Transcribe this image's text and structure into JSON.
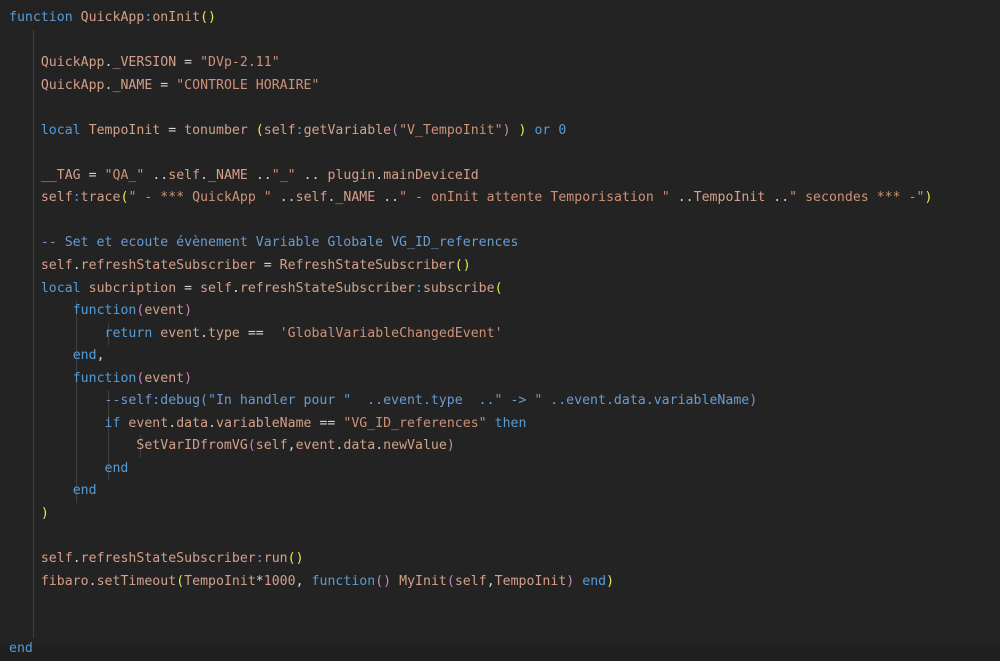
{
  "editor": {
    "language": "lua",
    "background_color": "#232323",
    "indent_guide_color": "#404040",
    "font_size_px": 13,
    "line_height_px": 23,
    "tab_size": 4,
    "colors": {
      "keyword": "#569cd6",
      "identifier": "#d4a08a",
      "string": "#ce9178",
      "comment": "#6a9bd1",
      "operator": "#d4d4d4",
      "bracket_level_1": "#e8e84f",
      "bracket_level_2": "#c586c0",
      "bracket_level_3": "#569cd6"
    }
  },
  "code": {
    "title": "QuickApp:onInit",
    "lines": [
      {
        "n": 1,
        "indent": 0,
        "guides": [],
        "text": "function QuickApp:onInit()"
      },
      {
        "n": 2,
        "indent": 0,
        "guides": [
          0
        ],
        "text": ""
      },
      {
        "n": 3,
        "indent": 1,
        "guides": [
          0
        ],
        "text": "    QuickApp._VERSION = \"DVp-2.11\""
      },
      {
        "n": 4,
        "indent": 1,
        "guides": [
          0
        ],
        "text": "    QuickApp._NAME = \"CONTROLE HORAIRE\""
      },
      {
        "n": 5,
        "indent": 1,
        "guides": [
          0
        ],
        "text": ""
      },
      {
        "n": 6,
        "indent": 1,
        "guides": [
          0
        ],
        "text": "    local TempoInit = tonumber (self:getVariable(\"V_TempoInit\") ) or 0"
      },
      {
        "n": 7,
        "indent": 1,
        "guides": [
          0
        ],
        "text": ""
      },
      {
        "n": 8,
        "indent": 1,
        "guides": [
          0
        ],
        "text": "    __TAG = \"QA_\" ..self._NAME ..\"_\" .. plugin.mainDeviceId"
      },
      {
        "n": 9,
        "indent": 1,
        "guides": [
          0
        ],
        "text": "    self:trace(\" - *** QuickApp \" ..self._NAME ..\" - onInit attente Temporisation \" ..TempoInit ..\" secondes *** -\")"
      },
      {
        "n": 10,
        "indent": 1,
        "guides": [
          0
        ],
        "text": ""
      },
      {
        "n": 11,
        "indent": 1,
        "guides": [
          0
        ],
        "text": "    -- Set et ecoute évènement Variable Globale VG_ID_references"
      },
      {
        "n": 12,
        "indent": 1,
        "guides": [
          0
        ],
        "text": "    self.refreshStateSubscriber = RefreshStateSubscriber()"
      },
      {
        "n": 13,
        "indent": 1,
        "guides": [
          0
        ],
        "text": "    local subcription = self.refreshStateSubscriber:subscribe("
      },
      {
        "n": 14,
        "indent": 2,
        "guides": [
          0,
          1
        ],
        "text": "        function(event)"
      },
      {
        "n": 15,
        "indent": 3,
        "guides": [
          0,
          1,
          2
        ],
        "text": "            return event.type ==  'GlobalVariableChangedEvent'"
      },
      {
        "n": 16,
        "indent": 2,
        "guides": [
          0,
          1
        ],
        "text": "        end,"
      },
      {
        "n": 17,
        "indent": 2,
        "guides": [
          0,
          1
        ],
        "text": "        function(event)"
      },
      {
        "n": 18,
        "indent": 3,
        "guides": [
          0,
          1,
          2
        ],
        "text": "            --self:debug(\"In handler pour \"  ..event.type  ..\" -> \" ..event.data.variableName)"
      },
      {
        "n": 19,
        "indent": 3,
        "guides": [
          0,
          1,
          2
        ],
        "text": "            if event.data.variableName == \"VG_ID_references\" then"
      },
      {
        "n": 20,
        "indent": 4,
        "guides": [
          0,
          1,
          2,
          3
        ],
        "text": "                SetVarIDfromVG(self,event.data.newValue)"
      },
      {
        "n": 21,
        "indent": 3,
        "guides": [
          0,
          1,
          2
        ],
        "text": "            end"
      },
      {
        "n": 22,
        "indent": 2,
        "guides": [
          0,
          1
        ],
        "text": "        end"
      },
      {
        "n": 23,
        "indent": 1,
        "guides": [
          0
        ],
        "text": "    )"
      },
      {
        "n": 24,
        "indent": 1,
        "guides": [
          0
        ],
        "text": ""
      },
      {
        "n": 25,
        "indent": 1,
        "guides": [
          0
        ],
        "text": "    self.refreshStateSubscriber:run()"
      },
      {
        "n": 26,
        "indent": 1,
        "guides": [
          0
        ],
        "text": "    fibaro.setTimeout(TempoInit*1000, function() MyInit(self,TempoInit) end)"
      },
      {
        "n": 27,
        "indent": 1,
        "guides": [
          0
        ],
        "text": ""
      },
      {
        "n": 28,
        "indent": 0,
        "guides": [
          0
        ],
        "text": ""
      },
      {
        "n": 29,
        "indent": 0,
        "guides": [],
        "text": "end"
      }
    ],
    "tokens": [
      [
        {
          "t": "function",
          "c": "kw"
        },
        {
          "t": " ",
          "c": "op"
        },
        {
          "t": "QuickApp",
          "c": "ident"
        },
        {
          "t": ":",
          "c": "punc"
        },
        {
          "t": "onInit",
          "c": "ident"
        },
        {
          "t": "()",
          "c": "py"
        }
      ],
      [],
      [
        {
          "t": "    ",
          "c": "op"
        },
        {
          "t": "QuickApp",
          "c": "ident"
        },
        {
          "t": ".",
          "c": "op"
        },
        {
          "t": "_VERSION",
          "c": "ident"
        },
        {
          "t": " = ",
          "c": "op"
        },
        {
          "t": "\"DVp-2.11\"",
          "c": "str"
        }
      ],
      [
        {
          "t": "    ",
          "c": "op"
        },
        {
          "t": "QuickApp",
          "c": "ident"
        },
        {
          "t": ".",
          "c": "op"
        },
        {
          "t": "_NAME",
          "c": "ident"
        },
        {
          "t": " = ",
          "c": "op"
        },
        {
          "t": "\"CONTROLE HORAIRE\"",
          "c": "str"
        }
      ],
      [],
      [
        {
          "t": "    ",
          "c": "op"
        },
        {
          "t": "local",
          "c": "kw"
        },
        {
          "t": " TempoInit ",
          "c": "ident"
        },
        {
          "t": "= ",
          "c": "op"
        },
        {
          "t": "tonumber ",
          "c": "ident"
        },
        {
          "t": "(",
          "c": "py"
        },
        {
          "t": "self",
          "c": "ident"
        },
        {
          "t": ":",
          "c": "punc"
        },
        {
          "t": "getVariable",
          "c": "ident"
        },
        {
          "t": "(",
          "c": "pm"
        },
        {
          "t": "\"V_TempoInit\"",
          "c": "str"
        },
        {
          "t": ")",
          "c": "pm"
        },
        {
          "t": " ",
          "c": "op"
        },
        {
          "t": ")",
          "c": "py"
        },
        {
          "t": " ",
          "c": "op"
        },
        {
          "t": "or",
          "c": "kw"
        },
        {
          "t": " ",
          "c": "op"
        },
        {
          "t": "0",
          "c": "kw"
        }
      ],
      [],
      [
        {
          "t": "    ",
          "c": "op"
        },
        {
          "t": "__TAG",
          "c": "ident"
        },
        {
          "t": " = ",
          "c": "op"
        },
        {
          "t": "\"QA_\"",
          "c": "str"
        },
        {
          "t": " ",
          "c": "op"
        },
        {
          "t": "..",
          "c": "op"
        },
        {
          "t": "self",
          "c": "ident"
        },
        {
          "t": ".",
          "c": "op"
        },
        {
          "t": "_NAME",
          "c": "ident"
        },
        {
          "t": " ",
          "c": "op"
        },
        {
          "t": "..",
          "c": "op"
        },
        {
          "t": "\"_\"",
          "c": "str"
        },
        {
          "t": " .. ",
          "c": "op"
        },
        {
          "t": "plugin",
          "c": "ident"
        },
        {
          "t": ".",
          "c": "op"
        },
        {
          "t": "mainDeviceId",
          "c": "ident"
        }
      ],
      [
        {
          "t": "    ",
          "c": "op"
        },
        {
          "t": "self",
          "c": "ident"
        },
        {
          "t": ":",
          "c": "punc"
        },
        {
          "t": "trace",
          "c": "ident"
        },
        {
          "t": "(",
          "c": "py"
        },
        {
          "t": "\" - *** QuickApp \"",
          "c": "str"
        },
        {
          "t": " ",
          "c": "op"
        },
        {
          "t": "..",
          "c": "op"
        },
        {
          "t": "self",
          "c": "ident"
        },
        {
          "t": ".",
          "c": "op"
        },
        {
          "t": "_NAME",
          "c": "ident"
        },
        {
          "t": " ",
          "c": "op"
        },
        {
          "t": "..",
          "c": "op"
        },
        {
          "t": "\" - onInit attente Temporisation \"",
          "c": "str"
        },
        {
          "t": " ",
          "c": "op"
        },
        {
          "t": "..",
          "c": "op"
        },
        {
          "t": "TempoInit",
          "c": "ident"
        },
        {
          "t": " ",
          "c": "op"
        },
        {
          "t": "..",
          "c": "op"
        },
        {
          "t": "\" secondes *** -\"",
          "c": "str"
        },
        {
          "t": ")",
          "c": "py"
        }
      ],
      [],
      [
        {
          "t": "    ",
          "c": "op"
        },
        {
          "t": "-- Set et ecoute évènement Variable Globale VG_ID_references",
          "c": "cmt"
        }
      ],
      [
        {
          "t": "    ",
          "c": "op"
        },
        {
          "t": "self",
          "c": "ident"
        },
        {
          "t": ".",
          "c": "op"
        },
        {
          "t": "refreshStateSubscriber",
          "c": "ident"
        },
        {
          "t": " = ",
          "c": "op"
        },
        {
          "t": "RefreshStateSubscriber",
          "c": "ident"
        },
        {
          "t": "()",
          "c": "py"
        }
      ],
      [
        {
          "t": "    ",
          "c": "op"
        },
        {
          "t": "local",
          "c": "kw"
        },
        {
          "t": " subcription ",
          "c": "ident"
        },
        {
          "t": "= ",
          "c": "op"
        },
        {
          "t": "self",
          "c": "ident"
        },
        {
          "t": ".",
          "c": "op"
        },
        {
          "t": "refreshStateSubscriber",
          "c": "ident"
        },
        {
          "t": ":",
          "c": "punc"
        },
        {
          "t": "subscribe",
          "c": "ident"
        },
        {
          "t": "(",
          "c": "py"
        }
      ],
      [
        {
          "t": "        ",
          "c": "op"
        },
        {
          "t": "function",
          "c": "kw"
        },
        {
          "t": "(",
          "c": "pm"
        },
        {
          "t": "event",
          "c": "ident"
        },
        {
          "t": ")",
          "c": "pm"
        }
      ],
      [
        {
          "t": "            ",
          "c": "op"
        },
        {
          "t": "return",
          "c": "kw"
        },
        {
          "t": " ",
          "c": "op"
        },
        {
          "t": "event",
          "c": "ident"
        },
        {
          "t": ".",
          "c": "op"
        },
        {
          "t": "type",
          "c": "ident"
        },
        {
          "t": " == ",
          "c": "op"
        },
        {
          "t": " ",
          "c": "op"
        },
        {
          "t": "'GlobalVariableChangedEvent'",
          "c": "str"
        }
      ],
      [
        {
          "t": "        ",
          "c": "op"
        },
        {
          "t": "end",
          "c": "kw"
        },
        {
          "t": ",",
          "c": "op"
        }
      ],
      [
        {
          "t": "        ",
          "c": "op"
        },
        {
          "t": "function",
          "c": "kw"
        },
        {
          "t": "(",
          "c": "pm"
        },
        {
          "t": "event",
          "c": "ident"
        },
        {
          "t": ")",
          "c": "pm"
        }
      ],
      [
        {
          "t": "            ",
          "c": "op"
        },
        {
          "t": "--self:debug(\"In handler pour \"  ..event.type  ..\" -> \" ..event.data.variableName)",
          "c": "cmt"
        }
      ],
      [
        {
          "t": "            ",
          "c": "op"
        },
        {
          "t": "if",
          "c": "kw"
        },
        {
          "t": " ",
          "c": "op"
        },
        {
          "t": "event",
          "c": "ident"
        },
        {
          "t": ".",
          "c": "op"
        },
        {
          "t": "data",
          "c": "ident"
        },
        {
          "t": ".",
          "c": "op"
        },
        {
          "t": "variableName",
          "c": "ident"
        },
        {
          "t": " == ",
          "c": "op"
        },
        {
          "t": "\"VG_ID_references\"",
          "c": "str"
        },
        {
          "t": " ",
          "c": "op"
        },
        {
          "t": "then",
          "c": "kw"
        }
      ],
      [
        {
          "t": "                ",
          "c": "op"
        },
        {
          "t": "SetVarIDfromVG",
          "c": "ident"
        },
        {
          "t": "(",
          "c": "pm"
        },
        {
          "t": "self",
          "c": "ident"
        },
        {
          "t": ",",
          "c": "op"
        },
        {
          "t": "event",
          "c": "ident"
        },
        {
          "t": ".",
          "c": "op"
        },
        {
          "t": "data",
          "c": "ident"
        },
        {
          "t": ".",
          "c": "op"
        },
        {
          "t": "newValue",
          "c": "ident"
        },
        {
          "t": ")",
          "c": "pm"
        }
      ],
      [
        {
          "t": "            ",
          "c": "op"
        },
        {
          "t": "end",
          "c": "kw"
        }
      ],
      [
        {
          "t": "        ",
          "c": "op"
        },
        {
          "t": "end",
          "c": "kw"
        }
      ],
      [
        {
          "t": "    ",
          "c": "op"
        },
        {
          "t": ")",
          "c": "py"
        }
      ],
      [],
      [
        {
          "t": "    ",
          "c": "op"
        },
        {
          "t": "self",
          "c": "ident"
        },
        {
          "t": ".",
          "c": "op"
        },
        {
          "t": "refreshStateSubscriber",
          "c": "ident"
        },
        {
          "t": ":",
          "c": "punc"
        },
        {
          "t": "run",
          "c": "ident"
        },
        {
          "t": "()",
          "c": "py"
        }
      ],
      [
        {
          "t": "    ",
          "c": "op"
        },
        {
          "t": "fibaro",
          "c": "ident"
        },
        {
          "t": ".",
          "c": "op"
        },
        {
          "t": "setTimeout",
          "c": "ident"
        },
        {
          "t": "(",
          "c": "py"
        },
        {
          "t": "TempoInit",
          "c": "ident"
        },
        {
          "t": "*",
          "c": "op"
        },
        {
          "t": "1000",
          "c": "ident"
        },
        {
          "t": ", ",
          "c": "op"
        },
        {
          "t": "function",
          "c": "kw"
        },
        {
          "t": "()",
          "c": "pm"
        },
        {
          "t": " ",
          "c": "op"
        },
        {
          "t": "MyInit",
          "c": "ident"
        },
        {
          "t": "(",
          "c": "pm"
        },
        {
          "t": "self",
          "c": "ident"
        },
        {
          "t": ",",
          "c": "op"
        },
        {
          "t": "TempoInit",
          "c": "ident"
        },
        {
          "t": ")",
          "c": "pm"
        },
        {
          "t": " ",
          "c": "op"
        },
        {
          "t": "end",
          "c": "kw"
        },
        {
          "t": ")",
          "c": "py"
        }
      ],
      [],
      [],
      [
        {
          "t": "end",
          "c": "kw"
        }
      ]
    ]
  }
}
